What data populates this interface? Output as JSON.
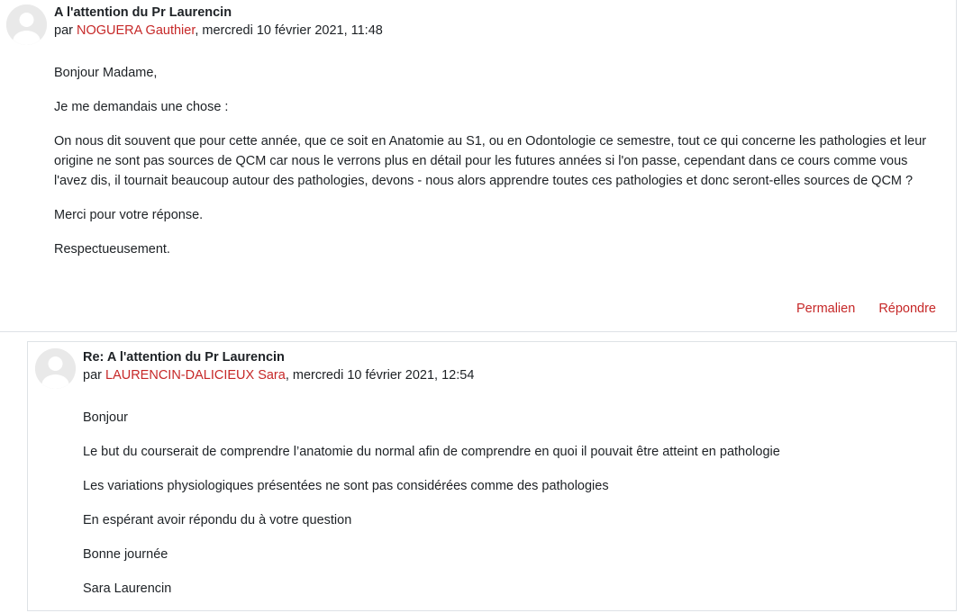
{
  "posts": [
    {
      "subject": "A l'attention du Pr Laurencin",
      "by_prefix": "par",
      "author": "NOGUERA Gauthier",
      "date": ", mercredi 10 février 2021, 11:48",
      "paragraphs": [
        "Bonjour Madame,",
        "Je me demandais une chose :",
        "On nous dit souvent que pour cette année, que ce soit en Anatomie au S1, ou en Odontologie ce semestre, tout ce qui concerne les pathologies et leur origine ne sont pas sources de QCM car nous le verrons plus en détail pour les futures années si l'on passe, cependant dans ce cours comme vous l'avez dis, il tournait beaucoup autour des pathologies, devons - nous alors apprendre toutes ces pathologies et donc seront-elles sources de QCM ?",
        "Merci pour votre réponse.",
        "Respectueusement."
      ],
      "actions": {
        "permalink": "Permalien",
        "reply": "Répondre"
      }
    },
    {
      "subject": "Re: A l'attention du Pr Laurencin",
      "by_prefix": "par",
      "author": "LAURENCIN-DALICIEUX Sara",
      "date": ", mercredi 10 février 2021, 12:54",
      "paragraphs": [
        "Bonjour",
        "Le but du courserait de comprendre l’anatomie du normal afin de comprendre en quoi il pouvait être atteint en pathologie",
        "Les variations physiologiques présentées ne sont pas considérées comme des pathologies",
        "En espérant avoir répondu du à votre question",
        "Bonne journée",
        "Sara Laurencin"
      ]
    }
  ],
  "colors": {
    "accent": "#c62828",
    "text": "#1d2125",
    "border": "#dee2e6",
    "avatar_bg": "#e9e9e9",
    "avatar_fg": "#ffffff"
  },
  "icons": {
    "avatar": "default-user-avatar-icon"
  }
}
